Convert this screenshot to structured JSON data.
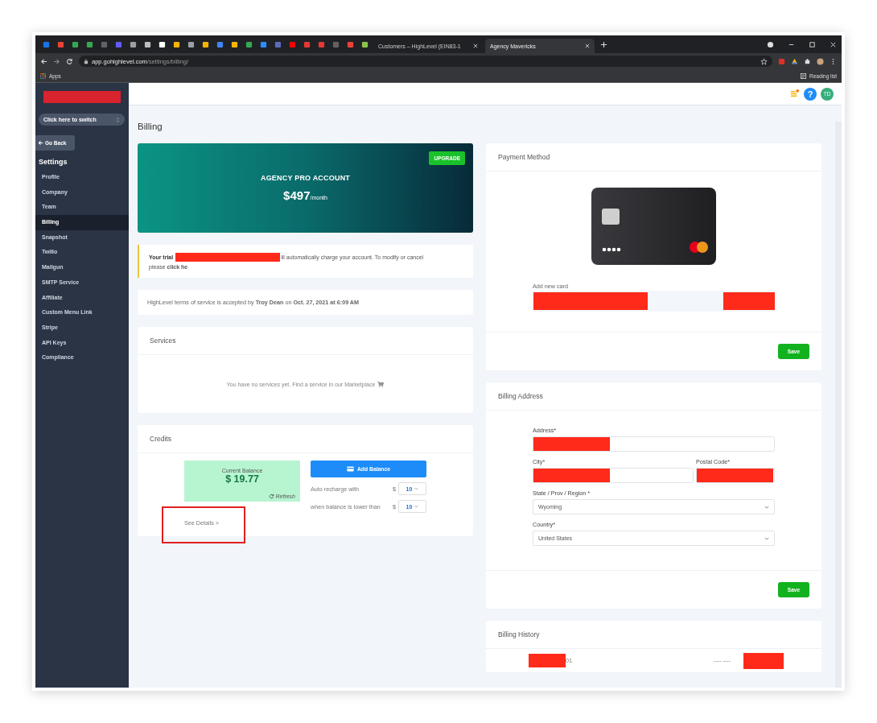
{
  "browser": {
    "tabs": [
      {
        "title": "Customers – HighLevel (EIN83-1",
        "selected": false
      },
      {
        "title": "Agency Mavericks",
        "selected": true
      }
    ],
    "url": {
      "host": "app.gohighlevel.com",
      "path": "/settings/billing/"
    },
    "bookmarks": [
      "Apps"
    ],
    "reading_list": "Reading list"
  },
  "sidebar": {
    "logo_redacted": true,
    "switcher": "Click here to switch",
    "back": "Go Back",
    "heading": "Settings",
    "items": [
      {
        "label": "Profile",
        "selected": false
      },
      {
        "label": "Company",
        "selected": false
      },
      {
        "label": "Team",
        "selected": false
      },
      {
        "label": "Billing",
        "selected": true
      },
      {
        "label": "Snapshot",
        "selected": false
      },
      {
        "label": "Twilio",
        "selected": false
      },
      {
        "label": "Mailgun",
        "selected": false
      },
      {
        "label": "SMTP Service",
        "selected": false
      },
      {
        "label": "Affiliate",
        "selected": false
      },
      {
        "label": "Custom Menu Link",
        "selected": false
      },
      {
        "label": "Stripe",
        "selected": false
      },
      {
        "label": "API Keys",
        "selected": false
      },
      {
        "label": "Compliance",
        "selected": false
      }
    ]
  },
  "header": {
    "help": "?",
    "avatar": "TD"
  },
  "page_title": "Billing",
  "plan": {
    "name": "AGENCY PRO ACCOUNT",
    "price": "$497",
    "period": "/month",
    "button": "UPGRADE"
  },
  "trial_notice": {
    "lead": "Your trial",
    "line_1": "ill automatically charge your account. To modify or cancel",
    "line_2": "please **click he**",
    "redacted": true
  },
  "terms": "HighLevel terms of service is accepted by **Troy Dean** on **Oct. 27, 2021 at 6:09 AM**",
  "services": {
    "title": "Services",
    "empty": "You have no services yet. Find a service in our Marketplace"
  },
  "credits": {
    "title": "Credits",
    "balance_label": "Current Balance",
    "balance": "$ 19.77",
    "refresh": "Refresh",
    "add_button": "Add Balance",
    "see_details": "See Details >",
    "highlighted": true,
    "rules": [
      {
        "label": "Auto recharge with",
        "currency": "$",
        "value": "10"
      },
      {
        "label": "when balance is lower than",
        "currency": "$",
        "value": "10"
      }
    ]
  },
  "payment": {
    "title": "Payment Method",
    "add_label": "Add new card",
    "redacted": true,
    "save": "Save"
  },
  "address": {
    "title": "Billing Address",
    "rows": [
      [
        {
          "label": "Address*",
          "kind": "input",
          "redacted": true
        }
      ],
      [
        {
          "label": "City*",
          "kind": "input",
          "redacted": true
        },
        {
          "label": "Postal Code*",
          "kind": "input",
          "redacted": true
        }
      ],
      [
        {
          "label": "State / Prov / Region *",
          "kind": "select",
          "value": "Wyoming"
        }
      ],
      [
        {
          "label": "Country*",
          "kind": "select",
          "value": "United States"
        }
      ]
    ],
    "save": "Save"
  },
  "history": {
    "title": "Billing History",
    "rows": [
      {
        "column_1": "01",
        "column_2": "---- ----",
        "redacted": true
      }
    ]
  }
}
